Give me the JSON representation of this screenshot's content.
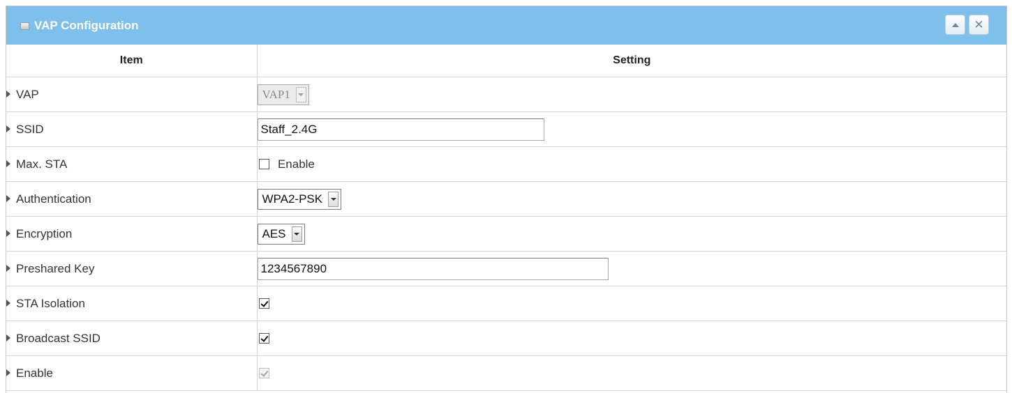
{
  "panel": {
    "title": "VAP Configuration",
    "collapse_icon": "triangle-up-icon",
    "close_icon": "close-x-icon",
    "accent_color": "#7ebfeb"
  },
  "table": {
    "headers": {
      "item": "Item",
      "setting": "Setting"
    },
    "rows": {
      "vap": {
        "label": "VAP",
        "value": "VAP1",
        "disabled": true
      },
      "ssid": {
        "label": "SSID",
        "value": "Staff_2.4G"
      },
      "max_sta": {
        "label": "Max. STA",
        "checkbox_label": "Enable",
        "checked": false
      },
      "authentication": {
        "label": "Authentication",
        "value": "WPA2-PSK"
      },
      "encryption": {
        "label": "Encryption",
        "value": "AES"
      },
      "preshared_key": {
        "label": "Preshared Key",
        "value": "1234567890"
      },
      "sta_isolation": {
        "label": "STA Isolation",
        "checked": true
      },
      "broadcast_ssid": {
        "label": "Broadcast SSID",
        "checked": true
      },
      "enable": {
        "label": "Enable",
        "checked": true,
        "disabled": true
      }
    }
  }
}
